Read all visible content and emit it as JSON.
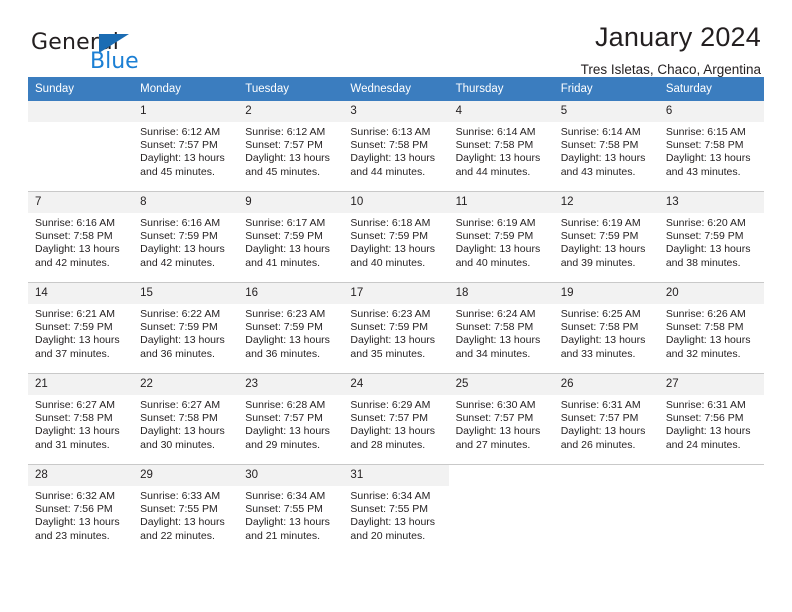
{
  "brand": {
    "word_one": "General",
    "word_two": "Blue",
    "triangle_color": "#1b6cb3",
    "blue_color": "#1b7fd4"
  },
  "header": {
    "title": "January 2024",
    "subtitle": "Tres Isletas, Chaco, Argentina"
  },
  "theme": {
    "header_bg": "#3b7dbf",
    "daynum_bg": "#f2f2f2",
    "grid_line": "#c9c9c9",
    "text": "#231f20"
  },
  "calendar": {
    "weekday_headers": [
      "Sunday",
      "Monday",
      "Tuesday",
      "Wednesday",
      "Thursday",
      "Friday",
      "Saturday"
    ],
    "weeks": [
      [
        {
          "day": "",
          "sunrise": "",
          "sunset": "",
          "daylight_1": "",
          "daylight_2": "",
          "empty": true
        },
        {
          "day": "1",
          "sunrise": "Sunrise: 6:12 AM",
          "sunset": "Sunset: 7:57 PM",
          "daylight_1": "Daylight: 13 hours",
          "daylight_2": "and 45 minutes."
        },
        {
          "day": "2",
          "sunrise": "Sunrise: 6:12 AM",
          "sunset": "Sunset: 7:57 PM",
          "daylight_1": "Daylight: 13 hours",
          "daylight_2": "and 45 minutes."
        },
        {
          "day": "3",
          "sunrise": "Sunrise: 6:13 AM",
          "sunset": "Sunset: 7:58 PM",
          "daylight_1": "Daylight: 13 hours",
          "daylight_2": "and 44 minutes."
        },
        {
          "day": "4",
          "sunrise": "Sunrise: 6:14 AM",
          "sunset": "Sunset: 7:58 PM",
          "daylight_1": "Daylight: 13 hours",
          "daylight_2": "and 44 minutes."
        },
        {
          "day": "5",
          "sunrise": "Sunrise: 6:14 AM",
          "sunset": "Sunset: 7:58 PM",
          "daylight_1": "Daylight: 13 hours",
          "daylight_2": "and 43 minutes."
        },
        {
          "day": "6",
          "sunrise": "Sunrise: 6:15 AM",
          "sunset": "Sunset: 7:58 PM",
          "daylight_1": "Daylight: 13 hours",
          "daylight_2": "and 43 minutes."
        }
      ],
      [
        {
          "day": "7",
          "sunrise": "Sunrise: 6:16 AM",
          "sunset": "Sunset: 7:58 PM",
          "daylight_1": "Daylight: 13 hours",
          "daylight_2": "and 42 minutes."
        },
        {
          "day": "8",
          "sunrise": "Sunrise: 6:16 AM",
          "sunset": "Sunset: 7:59 PM",
          "daylight_1": "Daylight: 13 hours",
          "daylight_2": "and 42 minutes."
        },
        {
          "day": "9",
          "sunrise": "Sunrise: 6:17 AM",
          "sunset": "Sunset: 7:59 PM",
          "daylight_1": "Daylight: 13 hours",
          "daylight_2": "and 41 minutes."
        },
        {
          "day": "10",
          "sunrise": "Sunrise: 6:18 AM",
          "sunset": "Sunset: 7:59 PM",
          "daylight_1": "Daylight: 13 hours",
          "daylight_2": "and 40 minutes."
        },
        {
          "day": "11",
          "sunrise": "Sunrise: 6:19 AM",
          "sunset": "Sunset: 7:59 PM",
          "daylight_1": "Daylight: 13 hours",
          "daylight_2": "and 40 minutes."
        },
        {
          "day": "12",
          "sunrise": "Sunrise: 6:19 AM",
          "sunset": "Sunset: 7:59 PM",
          "daylight_1": "Daylight: 13 hours",
          "daylight_2": "and 39 minutes."
        },
        {
          "day": "13",
          "sunrise": "Sunrise: 6:20 AM",
          "sunset": "Sunset: 7:59 PM",
          "daylight_1": "Daylight: 13 hours",
          "daylight_2": "and 38 minutes."
        }
      ],
      [
        {
          "day": "14",
          "sunrise": "Sunrise: 6:21 AM",
          "sunset": "Sunset: 7:59 PM",
          "daylight_1": "Daylight: 13 hours",
          "daylight_2": "and 37 minutes."
        },
        {
          "day": "15",
          "sunrise": "Sunrise: 6:22 AM",
          "sunset": "Sunset: 7:59 PM",
          "daylight_1": "Daylight: 13 hours",
          "daylight_2": "and 36 minutes."
        },
        {
          "day": "16",
          "sunrise": "Sunrise: 6:23 AM",
          "sunset": "Sunset: 7:59 PM",
          "daylight_1": "Daylight: 13 hours",
          "daylight_2": "and 36 minutes."
        },
        {
          "day": "17",
          "sunrise": "Sunrise: 6:23 AM",
          "sunset": "Sunset: 7:59 PM",
          "daylight_1": "Daylight: 13 hours",
          "daylight_2": "and 35 minutes."
        },
        {
          "day": "18",
          "sunrise": "Sunrise: 6:24 AM",
          "sunset": "Sunset: 7:58 PM",
          "daylight_1": "Daylight: 13 hours",
          "daylight_2": "and 34 minutes."
        },
        {
          "day": "19",
          "sunrise": "Sunrise: 6:25 AM",
          "sunset": "Sunset: 7:58 PM",
          "daylight_1": "Daylight: 13 hours",
          "daylight_2": "and 33 minutes."
        },
        {
          "day": "20",
          "sunrise": "Sunrise: 6:26 AM",
          "sunset": "Sunset: 7:58 PM",
          "daylight_1": "Daylight: 13 hours",
          "daylight_2": "and 32 minutes."
        }
      ],
      [
        {
          "day": "21",
          "sunrise": "Sunrise: 6:27 AM",
          "sunset": "Sunset: 7:58 PM",
          "daylight_1": "Daylight: 13 hours",
          "daylight_2": "and 31 minutes."
        },
        {
          "day": "22",
          "sunrise": "Sunrise: 6:27 AM",
          "sunset": "Sunset: 7:58 PM",
          "daylight_1": "Daylight: 13 hours",
          "daylight_2": "and 30 minutes."
        },
        {
          "day": "23",
          "sunrise": "Sunrise: 6:28 AM",
          "sunset": "Sunset: 7:57 PM",
          "daylight_1": "Daylight: 13 hours",
          "daylight_2": "and 29 minutes."
        },
        {
          "day": "24",
          "sunrise": "Sunrise: 6:29 AM",
          "sunset": "Sunset: 7:57 PM",
          "daylight_1": "Daylight: 13 hours",
          "daylight_2": "and 28 minutes."
        },
        {
          "day": "25",
          "sunrise": "Sunrise: 6:30 AM",
          "sunset": "Sunset: 7:57 PM",
          "daylight_1": "Daylight: 13 hours",
          "daylight_2": "and 27 minutes."
        },
        {
          "day": "26",
          "sunrise": "Sunrise: 6:31 AM",
          "sunset": "Sunset: 7:57 PM",
          "daylight_1": "Daylight: 13 hours",
          "daylight_2": "and 26 minutes."
        },
        {
          "day": "27",
          "sunrise": "Sunrise: 6:31 AM",
          "sunset": "Sunset: 7:56 PM",
          "daylight_1": "Daylight: 13 hours",
          "daylight_2": "and 24 minutes."
        }
      ],
      [
        {
          "day": "28",
          "sunrise": "Sunrise: 6:32 AM",
          "sunset": "Sunset: 7:56 PM",
          "daylight_1": "Daylight: 13 hours",
          "daylight_2": "and 23 minutes."
        },
        {
          "day": "29",
          "sunrise": "Sunrise: 6:33 AM",
          "sunset": "Sunset: 7:55 PM",
          "daylight_1": "Daylight: 13 hours",
          "daylight_2": "and 22 minutes."
        },
        {
          "day": "30",
          "sunrise": "Sunrise: 6:34 AM",
          "sunset": "Sunset: 7:55 PM",
          "daylight_1": "Daylight: 13 hours",
          "daylight_2": "and 21 minutes."
        },
        {
          "day": "31",
          "sunrise": "Sunrise: 6:34 AM",
          "sunset": "Sunset: 7:55 PM",
          "daylight_1": "Daylight: 13 hours",
          "daylight_2": "and 20 minutes."
        },
        {
          "day": "",
          "sunrise": "",
          "sunset": "",
          "daylight_1": "",
          "daylight_2": "",
          "blank": true
        },
        {
          "day": "",
          "sunrise": "",
          "sunset": "",
          "daylight_1": "",
          "daylight_2": "",
          "blank": true
        },
        {
          "day": "",
          "sunrise": "",
          "sunset": "",
          "daylight_1": "",
          "daylight_2": "",
          "blank": true
        }
      ]
    ]
  }
}
